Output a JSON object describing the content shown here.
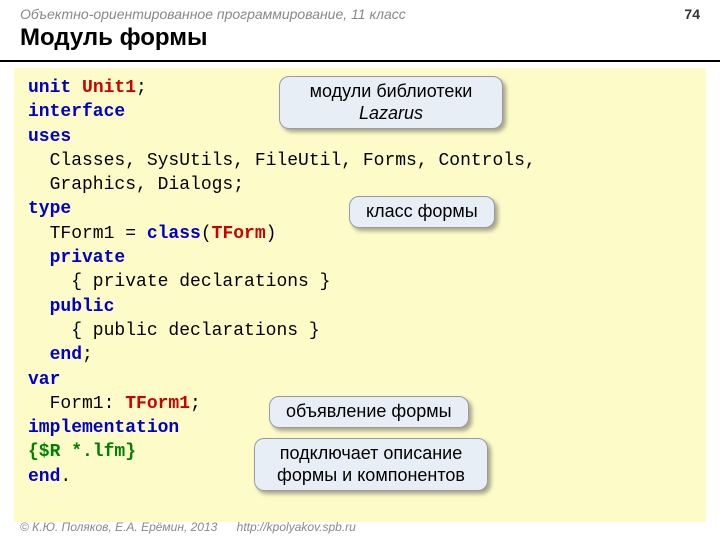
{
  "header": {
    "course": "Объектно-ориентированное программирование, 11 класс",
    "page": "74"
  },
  "title": "Модуль формы",
  "code": {
    "l1a": "unit ",
    "l1b": "Unit1",
    "l1c": ";",
    "l2": "interface",
    "l3": "uses",
    "l4": "  Classes, SysUtils, FileUtil, Forms, Controls,",
    "l5": "  Graphics, Dialogs;",
    "l6": "type",
    "l7a": "  TForm1 = ",
    "l7b": "class",
    "l7c": "(",
    "l7d": "TForm",
    "l7e": ")",
    "l8": "  private",
    "l9": "    { private declarations }",
    "l10": "  public",
    "l11": "    { public declarations }",
    "l12": "  end;",
    "l13": "var",
    "l14a": "  Form1: ",
    "l14b": "TForm1",
    "l14c": ";",
    "l15": "implementation",
    "l16": "{$R *.lfm}",
    "l17": "end."
  },
  "callouts": {
    "c1a": "модули библиотеки",
    "c1b": "Lazarus",
    "c2": "класс формы",
    "c3": "объявление формы",
    "c4": "подключает описание формы и компонентов"
  },
  "footer": {
    "copyright": "© К.Ю. Поляков, Е.А. Ерёмин, 2013",
    "url": "http://kpolyakov.spb.ru"
  }
}
